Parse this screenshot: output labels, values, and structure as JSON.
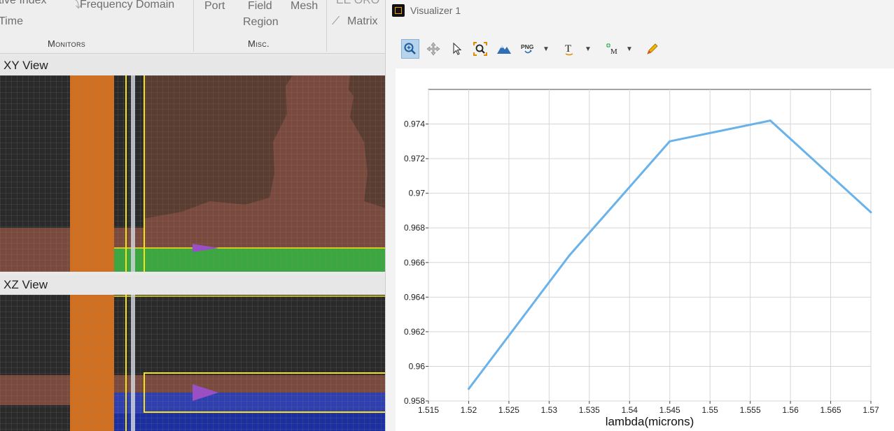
{
  "ribbon": {
    "items": {
      "refractive_index": "tive Index",
      "frequency_domain": "Frequency Domain",
      "time": "Time",
      "port": "Port",
      "field_region_line1": "Field",
      "field_region_line2": "Region",
      "mesh": "Mesh",
      "eme_cut": "EE ORO",
      "matrix": "Matrix"
    },
    "groups": {
      "monitors": "Monitors",
      "misc": "Misc."
    }
  },
  "views": {
    "xy_title": "XY View",
    "xz_title": "XZ View",
    "colors": {
      "background": "#2a2a2a",
      "substrate_orange": "#d26f1f",
      "structure_brown": "#7a4a3e",
      "port_green": "#3aa83e",
      "monitor_blue": "#2f3fb0",
      "boundary_yellow": "#f5e31b",
      "source_arrow": "#9b4fc4"
    }
  },
  "visualizer": {
    "title": "Visualizer 1",
    "toolbar": {
      "zoom": "zoom-icon",
      "pan": "pan-icon",
      "select": "pointer-icon",
      "zoom_extents": "zoom-extents-icon",
      "plot_style": "mountain-icon",
      "export_png": "PNG",
      "text": "T",
      "marker": "M",
      "pencil": "pencil-icon"
    }
  },
  "chart_data": {
    "type": "line",
    "title": "",
    "xlabel": "lambda(microns)",
    "ylabel": "",
    "xlim": [
      1.515,
      1.57
    ],
    "ylim": [
      0.958,
      0.976
    ],
    "grid": true,
    "x_ticks": [
      "1.515",
      "1.52",
      "1.525",
      "1.53",
      "1.535",
      "1.54",
      "1.545",
      "1.55",
      "1.555",
      "1.56",
      "1.565",
      "1.57"
    ],
    "y_ticks": [
      "0.958",
      "0.96",
      "0.962",
      "0.964",
      "0.966",
      "0.968",
      "0.97",
      "0.972",
      "0.974"
    ],
    "series": [
      {
        "color": "#6ab2ea",
        "x": [
          1.52,
          1.5325,
          1.545,
          1.5575,
          1.57
        ],
        "y": [
          0.9587,
          0.9664,
          0.973,
          0.9742,
          0.9689
        ]
      }
    ]
  }
}
